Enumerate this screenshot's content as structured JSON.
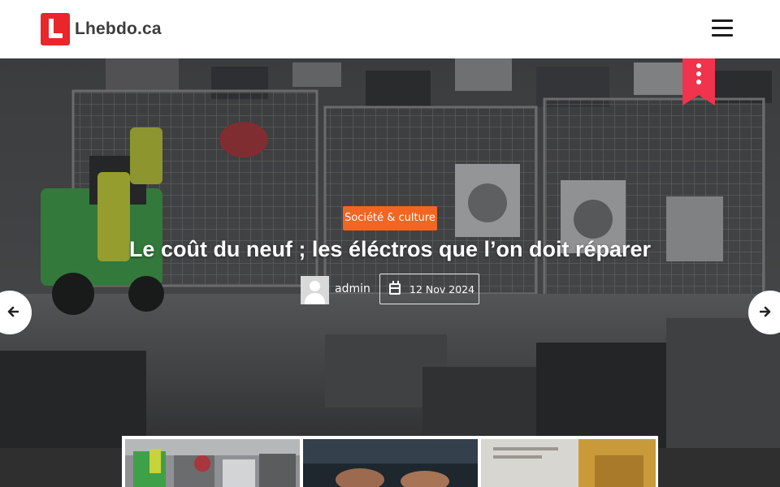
{
  "site": {
    "name": "Lhebdo.ca",
    "brand_color": "#e8262b"
  },
  "header": {
    "menu_icon": "hamburger-icon"
  },
  "hero": {
    "category": "Société & culture",
    "title": "Le coût du neuf ; les éléctros que l’on doit réparer",
    "author": "admin",
    "date": "12 Nov 2024",
    "category_color": "#f26522",
    "bookmark_color": "#f0344d"
  },
  "slider": {
    "prev_icon": "arrow-left-icon",
    "next_icon": "arrow-right-icon",
    "thumbnails": [
      "appliance-recycling-thumb",
      "laptop-hands-thumb",
      "document-plant-thumb"
    ]
  }
}
